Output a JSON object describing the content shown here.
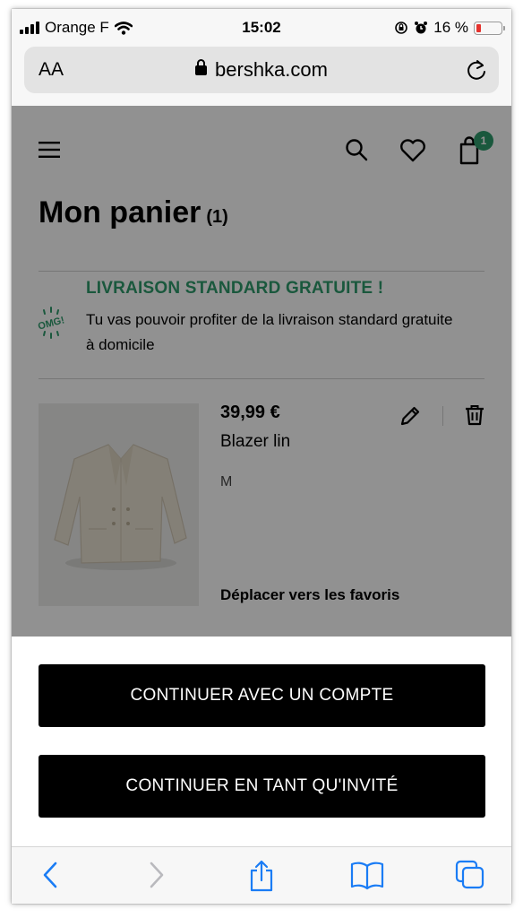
{
  "status_bar": {
    "carrier": "Orange F",
    "time": "15:02",
    "battery": "16 %"
  },
  "browser": {
    "text_size_label": "AA",
    "url": "bershka.com"
  },
  "header": {
    "cart_count": "1"
  },
  "cart": {
    "title": "Mon panier",
    "count": "(1)"
  },
  "promo": {
    "badge": "OMG!",
    "headline": "LIVRAISON STANDARD GRATUITE !",
    "text": "Tu vas pouvoir profiter de la livraison standard gratuite à domicile"
  },
  "item": {
    "price": "39,99 €",
    "name": "Blazer lin",
    "size": "M",
    "move_to_favorites": "Déplacer vers les favoris"
  },
  "sheet": {
    "account_button": "CONTINUER AVEC UN COMPTE",
    "guest_button": "CONTINUER EN TANT QU'INVITÉ"
  },
  "colors": {
    "accent_green": "#2e9b6c",
    "safari_blue": "#1a7cf5",
    "battery_red": "#e5322d"
  },
  "icons": [
    "menu-icon",
    "search-icon",
    "heart-icon",
    "bag-icon",
    "edit-icon",
    "trash-icon",
    "back-icon",
    "forward-icon",
    "share-icon",
    "bookmarks-icon",
    "tabs-icon"
  ]
}
